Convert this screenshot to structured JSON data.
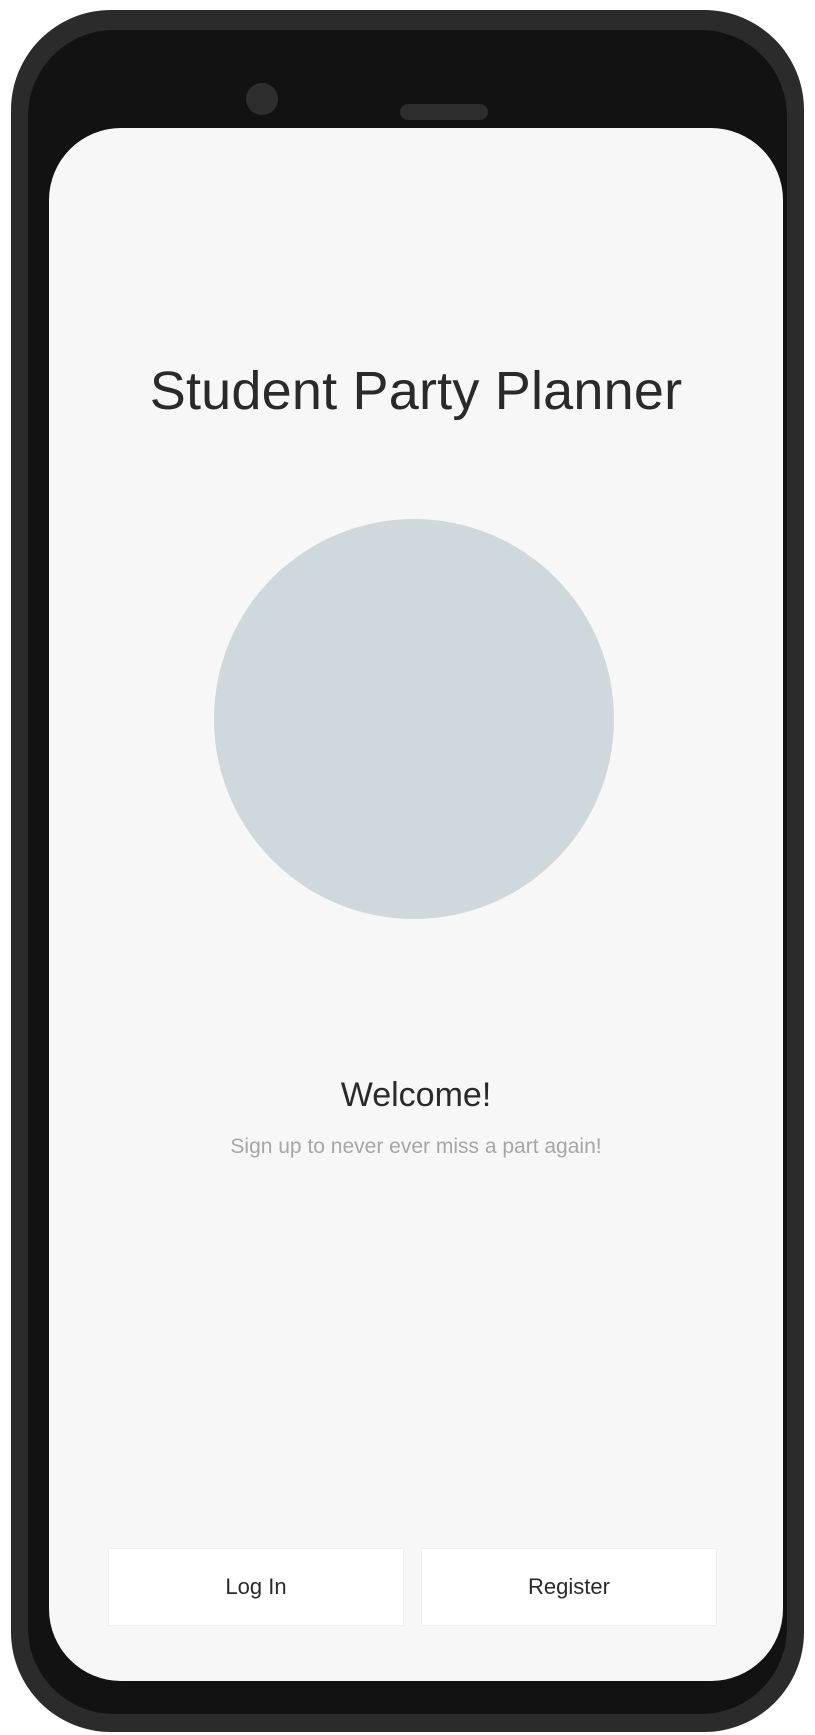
{
  "app": {
    "title": "Student Party Planner"
  },
  "welcome": {
    "title": "Welcome!",
    "subtitle": "Sign up to never ever miss a part again!"
  },
  "actions": {
    "login_label": "Log In",
    "register_label": "Register"
  },
  "colors": {
    "screen_background": "#f7f7f7",
    "hero_placeholder": "#cfd8dc",
    "text_primary": "#2a2a2a",
    "text_secondary": "#a6a6a6",
    "device_frame": "#2b2b2b"
  }
}
